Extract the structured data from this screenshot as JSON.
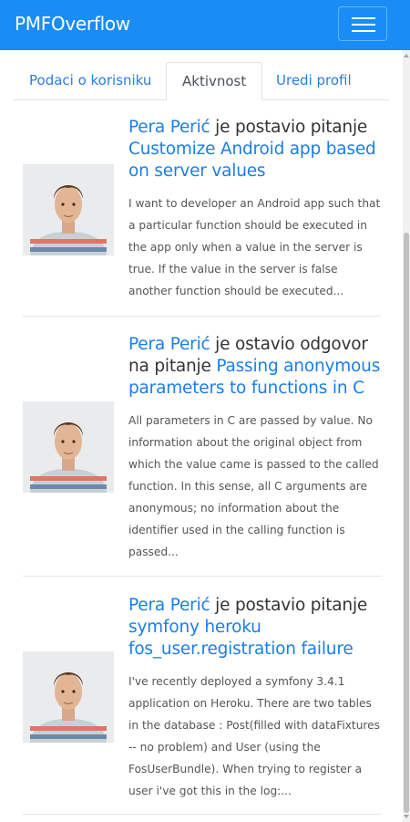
{
  "navbar": {
    "brand": "PMFOverflow",
    "menu_icon": "hamburger-menu-icon",
    "background": "#1a8cf6"
  },
  "tabs": [
    {
      "label": "Podaci o korisniku",
      "active": false
    },
    {
      "label": "Aktivnost",
      "active": true
    },
    {
      "label": "Uredi profil",
      "active": false
    }
  ],
  "activity": [
    {
      "user": "Pera Perić",
      "action": " je postavio pitanje ",
      "title": "Customize Android app based on server values",
      "excerpt": "I want to developer an Android app such that a particular function should be executed in the app only when a value in the server is true. If the value in the server is false another function should be executed..."
    },
    {
      "user": "Pera Perić",
      "action": " je ostavio odgovor na pitanje ",
      "title": "Passing anonymous parameters to functions in C",
      "excerpt": "All parameters in C are passed by value. No information about the original object from which the value came is passed to the called function. In this sense, all C arguments are anonymous; no information about the identifier used in the calling function is passed..."
    },
    {
      "user": "Pera Perić",
      "action": " je postavio pitanje ",
      "title": "symfony heroku fos_user.registration failure",
      "excerpt": "I've recently deployed a symfony 3.4.1 application on Heroku. There are two tables in the database : Post(filled with dataFixtures -- no problem) and User (using the FosUserBundle). When trying to register a user i've got this in the log:..."
    }
  ],
  "colors": {
    "link": "#1a7ee8",
    "tab_link": "#2a7de1",
    "text": "#333333"
  }
}
